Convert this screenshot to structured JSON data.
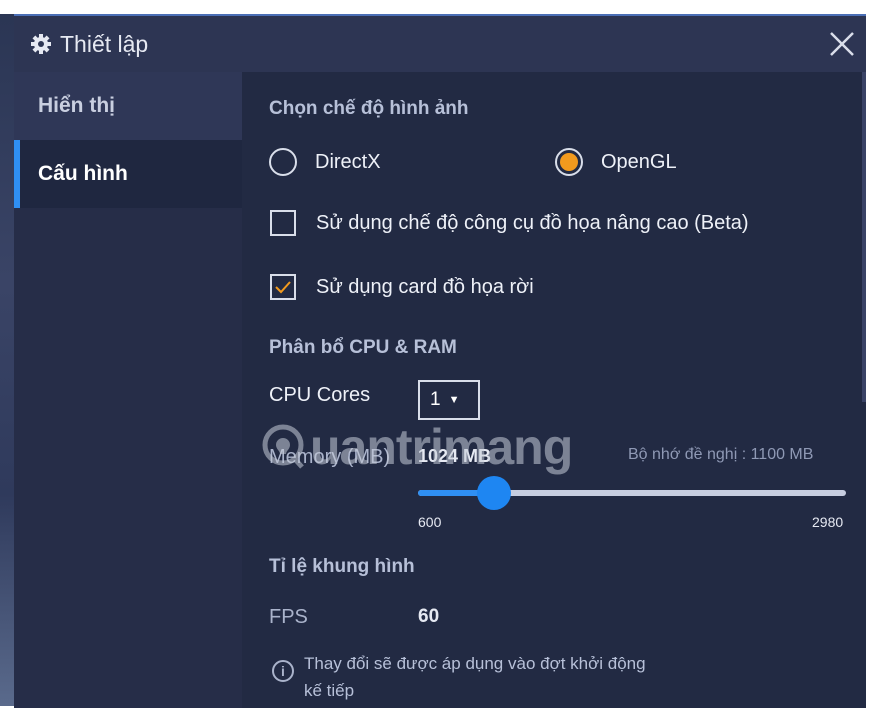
{
  "window": {
    "title": "Thiết lập",
    "icon": "gear-icon",
    "close_icon": "close-icon"
  },
  "sidebar": {
    "items": [
      {
        "label": "Hiển thị",
        "active": false
      },
      {
        "label": "Cấu hình",
        "active": true
      }
    ]
  },
  "graphics": {
    "section_title": "Chọn chế độ hình ảnh",
    "options": [
      {
        "label": "DirectX",
        "selected": false
      },
      {
        "label": "OpenGL",
        "selected": true
      }
    ],
    "advanced_engine_label": "Sử dụng chế độ công cụ đồ họa nâng cao (Beta)",
    "advanced_engine_checked": false,
    "dedicated_gpu_label": "Sử dụng card đồ họa rời",
    "dedicated_gpu_checked": true
  },
  "resources": {
    "section_title": "Phân bổ CPU & RAM",
    "cpu_label": "CPU Cores",
    "cpu_value": "1",
    "memory_label": "Memory (MB)",
    "memory_value": "1024 MB",
    "memory_hint": "Bộ nhớ đề nghị : 1100 MB",
    "slider_min": "600",
    "slider_max": "2980",
    "slider_current": 1024
  },
  "frame_rate": {
    "section_title": "Tỉ lệ khung hình",
    "fps_label": "FPS",
    "fps_value": "60",
    "note": "Thay đổi sẽ được áp dụng vào đợt khởi động kế tiếp"
  },
  "watermark": {
    "text": "uantrimang"
  },
  "colors": {
    "accent": "#2f8ff3",
    "radio_selected": "#f29a1e",
    "checkmark": "#f29a1e",
    "background": "#222a43"
  }
}
